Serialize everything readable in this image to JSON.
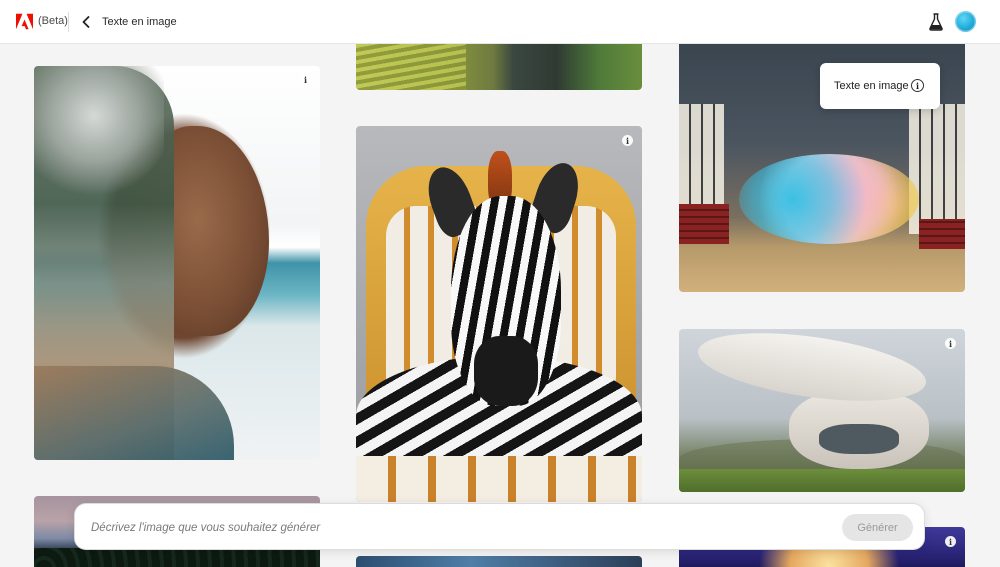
{
  "header": {
    "logo_icon": "adobe-logo-icon",
    "beta_label": "(Beta)",
    "back_icon": "chevron-left-icon",
    "breadcrumb": "Texte en image",
    "lab_icon": "flask-icon",
    "avatar_icon": "user-avatar"
  },
  "gallery": {
    "cards": [
      {
        "name": "woman-ocean-double-exposure",
        "info_icon": "info-icon"
      },
      {
        "name": "tea-field-landscape"
      },
      {
        "name": "zebra-on-golden-throne",
        "info_icon": "info-icon"
      },
      {
        "name": "colorful-smoke-warehouse"
      },
      {
        "name": "futuristic-white-house",
        "info_icon": "info-icon"
      },
      {
        "name": "tropical-sunset"
      },
      {
        "name": "blue-landscape"
      },
      {
        "name": "starry-celestial-scene",
        "info_icon": "info-icon"
      }
    ]
  },
  "tooltip": {
    "label": "Texte en image",
    "icon": "info-circle-icon"
  },
  "prompt": {
    "value": "",
    "placeholder": "Décrivez l'image que vous souhaitez générer",
    "generate_label": "Générer"
  },
  "colors": {
    "accent_avatar": "#1aa7d6",
    "adobe_red": "#eb1000",
    "button_disabled_bg": "#e5e5e5"
  }
}
